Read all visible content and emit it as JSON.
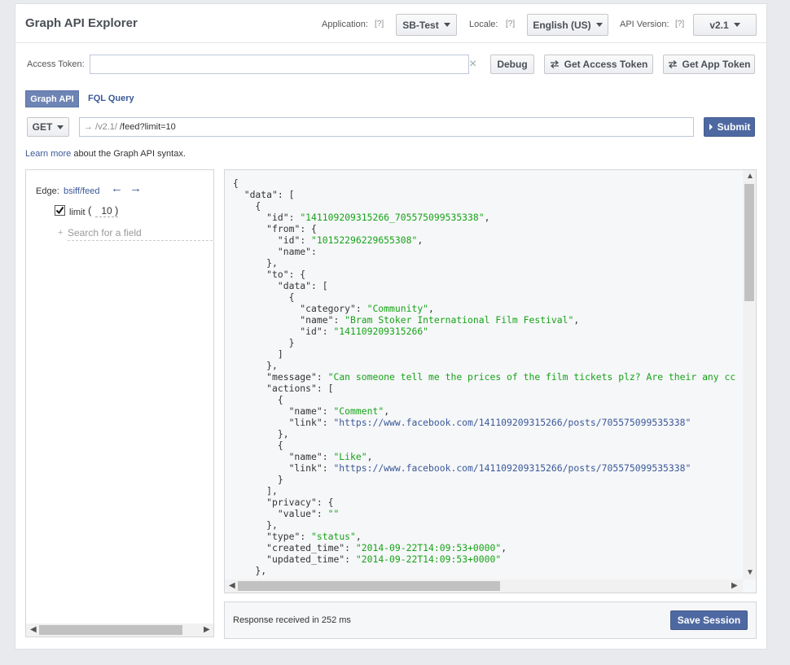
{
  "header": {
    "title": "Graph API Explorer",
    "application_label": "Application:",
    "application_help": "[?]",
    "application_value": "SB-Test",
    "locale_label": "Locale:",
    "locale_help": "[?]",
    "locale_value": "English (US)",
    "version_label": "API Version:",
    "version_help": "[?]",
    "version_value": "v2.1"
  },
  "token": {
    "label": "Access Token:",
    "value": "",
    "clear_glyph": "×",
    "debug_label": "Debug",
    "get_access_token_label": "Get Access Token",
    "get_app_token_label": "Get App Token"
  },
  "tabs": {
    "graph_api": "Graph API",
    "fql_query": "FQL Query"
  },
  "request": {
    "method": "GET",
    "prefix": "→ /v2.1/",
    "path": "/feed?limit=10",
    "submit_label": "Submit"
  },
  "learn_more": {
    "link": "Learn more",
    "text": " about the Graph API syntax."
  },
  "fields": {
    "edge_label": "Edge:",
    "edge_value": "bsiff/feed",
    "back_arrow": "←",
    "forward_arrow": "→",
    "limit_checked": true,
    "limit_label": "limit",
    "limit_open": "(",
    "limit_value": "10",
    "limit_close": ")",
    "search_plus": "+",
    "search_placeholder": "Search for a field"
  },
  "response": {
    "lines": [
      [
        [
          "p",
          "{"
        ]
      ],
      [
        [
          "p",
          "  "
        ],
        [
          "k",
          "\"data\""
        ],
        [
          "p",
          ": ["
        ]
      ],
      [
        [
          "p",
          "    {"
        ]
      ],
      [
        [
          "p",
          "      "
        ],
        [
          "k",
          "\"id\""
        ],
        [
          "p",
          ": "
        ],
        [
          "s",
          "\"141109209315266_705575099535338\""
        ],
        [
          "p",
          ","
        ]
      ],
      [
        [
          "p",
          "      "
        ],
        [
          "k",
          "\"from\""
        ],
        [
          "p",
          ": {"
        ]
      ],
      [
        [
          "p",
          "        "
        ],
        [
          "k",
          "\"id\""
        ],
        [
          "p",
          ": "
        ],
        [
          "s",
          "\"10152296229655308\""
        ],
        [
          "p",
          ","
        ]
      ],
      [
        [
          "p",
          "        "
        ],
        [
          "k",
          "\"name\""
        ],
        [
          "p",
          ":"
        ]
      ],
      [
        [
          "p",
          "      },"
        ]
      ],
      [
        [
          "p",
          "      "
        ],
        [
          "k",
          "\"to\""
        ],
        [
          "p",
          ": {"
        ]
      ],
      [
        [
          "p",
          "        "
        ],
        [
          "k",
          "\"data\""
        ],
        [
          "p",
          ": ["
        ]
      ],
      [
        [
          "p",
          "          {"
        ]
      ],
      [
        [
          "p",
          "            "
        ],
        [
          "k",
          "\"category\""
        ],
        [
          "p",
          ": "
        ],
        [
          "s",
          "\"Community\""
        ],
        [
          "p",
          ","
        ]
      ],
      [
        [
          "p",
          "            "
        ],
        [
          "k",
          "\"name\""
        ],
        [
          "p",
          ": "
        ],
        [
          "s",
          "\"Bram Stoker International Film Festival\""
        ],
        [
          "p",
          ","
        ]
      ],
      [
        [
          "p",
          "            "
        ],
        [
          "k",
          "\"id\""
        ],
        [
          "p",
          ": "
        ],
        [
          "s",
          "\"141109209315266\""
        ]
      ],
      [
        [
          "p",
          "          }"
        ]
      ],
      [
        [
          "p",
          "        ]"
        ]
      ],
      [
        [
          "p",
          "      },"
        ]
      ],
      [
        [
          "p",
          "      "
        ],
        [
          "k",
          "\"message\""
        ],
        [
          "p",
          ": "
        ],
        [
          "s",
          "\"Can someone tell me the prices of the film tickets plz? Are their any cc"
        ]
      ],
      [
        [
          "p",
          "      "
        ],
        [
          "k",
          "\"actions\""
        ],
        [
          "p",
          ": ["
        ]
      ],
      [
        [
          "p",
          "        {"
        ]
      ],
      [
        [
          "p",
          "          "
        ],
        [
          "k",
          "\"name\""
        ],
        [
          "p",
          ": "
        ],
        [
          "s",
          "\"Comment\""
        ],
        [
          "p",
          ","
        ]
      ],
      [
        [
          "p",
          "          "
        ],
        [
          "k",
          "\"link\""
        ],
        [
          "p",
          ": "
        ],
        [
          "u",
          "\"https://www.facebook.com/141109209315266/posts/705575099535338\""
        ]
      ],
      [
        [
          "p",
          "        },"
        ]
      ],
      [
        [
          "p",
          "        {"
        ]
      ],
      [
        [
          "p",
          "          "
        ],
        [
          "k",
          "\"name\""
        ],
        [
          "p",
          ": "
        ],
        [
          "s",
          "\"Like\""
        ],
        [
          "p",
          ","
        ]
      ],
      [
        [
          "p",
          "          "
        ],
        [
          "k",
          "\"link\""
        ],
        [
          "p",
          ": "
        ],
        [
          "u",
          "\"https://www.facebook.com/141109209315266/posts/705575099535338\""
        ]
      ],
      [
        [
          "p",
          "        }"
        ]
      ],
      [
        [
          "p",
          "      ],"
        ]
      ],
      [
        [
          "p",
          "      "
        ],
        [
          "k",
          "\"privacy\""
        ],
        [
          "p",
          ": {"
        ]
      ],
      [
        [
          "p",
          "        "
        ],
        [
          "k",
          "\"value\""
        ],
        [
          "p",
          ": "
        ],
        [
          "s",
          "\"\""
        ]
      ],
      [
        [
          "p",
          "      },"
        ]
      ],
      [
        [
          "p",
          "      "
        ],
        [
          "k",
          "\"type\""
        ],
        [
          "p",
          ": "
        ],
        [
          "s",
          "\"status\""
        ],
        [
          "p",
          ","
        ]
      ],
      [
        [
          "p",
          "      "
        ],
        [
          "k",
          "\"created_time\""
        ],
        [
          "p",
          ": "
        ],
        [
          "s",
          "\"2014-09-22T14:09:53+0000\""
        ],
        [
          "p",
          ","
        ]
      ],
      [
        [
          "p",
          "      "
        ],
        [
          "k",
          "\"updated_time\""
        ],
        [
          "p",
          ": "
        ],
        [
          "s",
          "\"2014-09-22T14:09:53+0000\""
        ]
      ],
      [
        [
          "p",
          "    },"
        ]
      ]
    ]
  },
  "status": {
    "text": "Response received in 252 ms",
    "save_label": "Save Session"
  }
}
